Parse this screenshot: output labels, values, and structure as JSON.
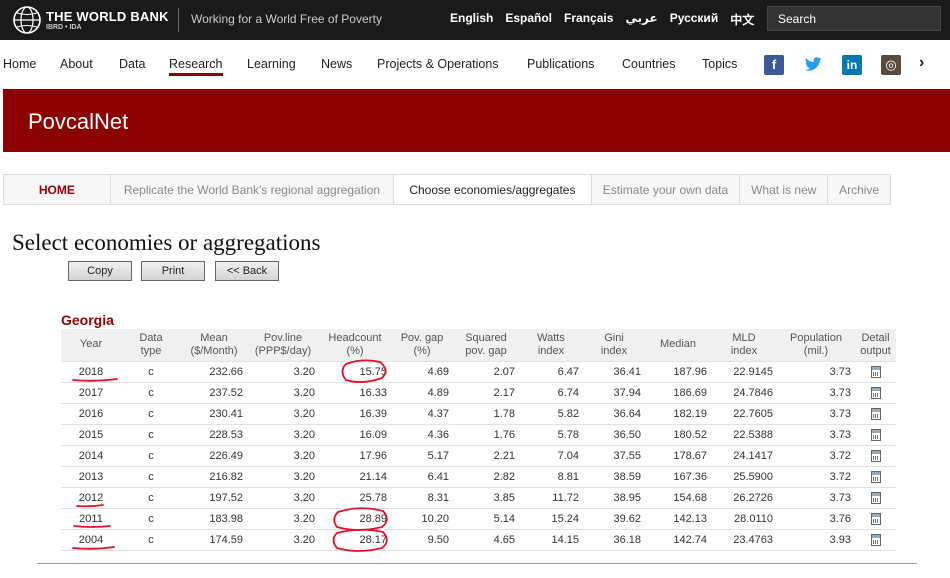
{
  "header": {
    "brand": "THE WORLD BANK",
    "brand_sub": "IBRD • IDA",
    "tagline": "Working for a World Free of Poverty",
    "languages": [
      "English",
      "Español",
      "Français",
      "عربي",
      "Русский",
      "中文"
    ],
    "search_placeholder": "Search"
  },
  "nav": {
    "items": [
      "Home",
      "About",
      "Data",
      "Research",
      "Learning",
      "News",
      "Projects & Operations",
      "Publications",
      "Countries",
      "Topics"
    ],
    "active": "Research",
    "social_icons": [
      "facebook-icon",
      "twitter-icon",
      "linkedin-icon",
      "instagram-icon"
    ],
    "social_glyphs": [
      "f",
      "t",
      "in",
      "◎"
    ],
    "more_glyph": "›"
  },
  "banner": {
    "title": "PovcalNet"
  },
  "tabs": {
    "items": [
      "HOME",
      "Replicate the World Bank's regional aggregation",
      "Choose economies/aggregates",
      "Estimate your own data",
      "What is new",
      "Archive"
    ],
    "current": "Choose economies/aggregates"
  },
  "page": {
    "heading": "Select economies or aggregations",
    "buttons": {
      "copy": "Copy",
      "print": "Print",
      "back": "<< Back"
    }
  },
  "table": {
    "country": "Georgia",
    "headers": [
      [
        "Year"
      ],
      [
        "Data",
        "type"
      ],
      [
        "Mean",
        "($/Month)"
      ],
      [
        "Pov.line",
        "(PPP$/day)"
      ],
      [
        "Headcount",
        "(%)"
      ],
      [
        "Pov. gap",
        "(%)"
      ],
      [
        "Squared",
        "pov. gap"
      ],
      [
        "Watts",
        "index"
      ],
      [
        "Gini",
        "index"
      ],
      [
        "Median"
      ],
      [
        "MLD",
        "index"
      ],
      [
        "Population",
        "(mil.)"
      ],
      [
        "Detail",
        "output"
      ]
    ],
    "rows": [
      [
        "2018",
        "c",
        "232.66",
        "3.20",
        "15.75",
        "4.69",
        "2.07",
        "6.47",
        "36.41",
        "187.96",
        "22.9145",
        "3.73"
      ],
      [
        "2017",
        "c",
        "237.52",
        "3.20",
        "16.33",
        "4.89",
        "2.17",
        "6.74",
        "37.94",
        "186.69",
        "24.7846",
        "3.73"
      ],
      [
        "2016",
        "c",
        "230.41",
        "3.20",
        "16.39",
        "4.37",
        "1.78",
        "5.82",
        "36.64",
        "182.19",
        "22.7605",
        "3.73"
      ],
      [
        "2015",
        "c",
        "228.53",
        "3.20",
        "16.09",
        "4.36",
        "1.76",
        "5.78",
        "36.50",
        "180.52",
        "22.5388",
        "3.73"
      ],
      [
        "2014",
        "c",
        "226.49",
        "3.20",
        "17.96",
        "5.17",
        "2.21",
        "7.04",
        "37.55",
        "178.67",
        "24.1417",
        "3.72"
      ],
      [
        "2013",
        "c",
        "216.82",
        "3.20",
        "21.14",
        "6.41",
        "2.82",
        "8.81",
        "38.59",
        "167.36",
        "25.5900",
        "3.72"
      ],
      [
        "2012",
        "c",
        "197.52",
        "3.20",
        "25.78",
        "8.31",
        "3.85",
        "11.72",
        "38.95",
        "154.68",
        "26.2726",
        "3.73"
      ],
      [
        "2011",
        "c",
        "183.98",
        "3.20",
        "28.89",
        "10.20",
        "5.14",
        "15.24",
        "39.62",
        "142.13",
        "28.0110",
        "3.76"
      ],
      [
        "2004",
        "c",
        "174.59",
        "3.20",
        "28.17",
        "9.50",
        "4.65",
        "14.15",
        "36.18",
        "142.74",
        "23.4763",
        "3.93"
      ]
    ]
  },
  "colors": {
    "brand_red": "#8b0000",
    "annotation_red": "#e0102a",
    "topbar": "#1a1a1a"
  }
}
